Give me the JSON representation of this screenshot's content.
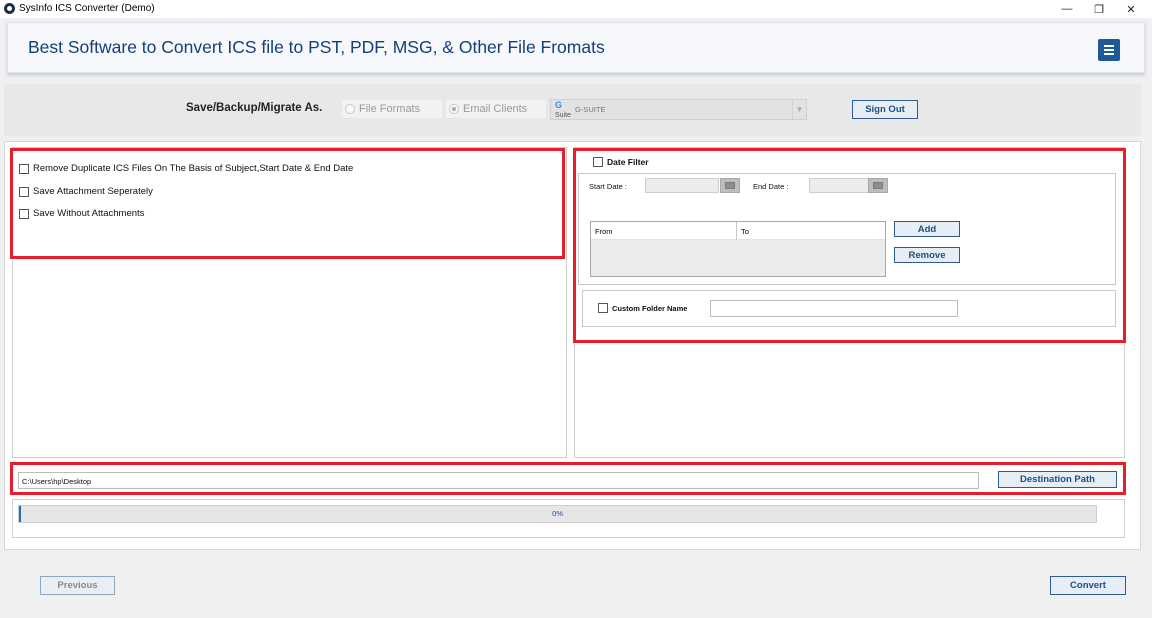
{
  "window": {
    "title": "SysInfo ICS Converter (Demo)",
    "minimize_icon": "minimize-icon",
    "maximize_icon": "restore-icon",
    "close_icon": "close-icon",
    "min_glyph": "—",
    "max_glyph": "❐",
    "close_glyph": "✕"
  },
  "header": {
    "headline": "Best Software to Convert ICS file to PST, PDF, MSG, & Other File Fromats",
    "menu_icon": "hamburger-menu-icon"
  },
  "save_options": {
    "label": "Save/Backup/Migrate As.",
    "radio_file_formats": "File Formats",
    "radio_email_clients": "Email Clients",
    "selected_radio": "Email Clients",
    "client_select_value": "G-SUITE",
    "client_logo_g": "G",
    "client_logo_suite": "Suite",
    "sign_out": "Sign Out"
  },
  "filters": {
    "remove_duplicates": "Remove Duplicate ICS Files On The Basis of Subject,Start Date & End Date",
    "save_attachment_separately": "Save Attachment Seperately",
    "save_without_attachments": "Save Without Attachments"
  },
  "date_filter": {
    "label": "Date Filter",
    "start_date_label": "Start Date :",
    "end_date_label": "End Date :",
    "columns": [
      "From",
      "To"
    ],
    "add": "Add",
    "remove": "Remove"
  },
  "custom_folder": {
    "label": "Custom Folder Name",
    "value": ""
  },
  "destination": {
    "path": "C:\\Users\\hp\\Desktop",
    "button": "Destination Path"
  },
  "progress": {
    "percent_label": "0%",
    "value": 0
  },
  "footer": {
    "previous": "Previous",
    "convert": "Convert"
  },
  "colors": {
    "accent": "#1d4f86",
    "highlight": "#e41e2d",
    "headline": "#143f7a"
  }
}
